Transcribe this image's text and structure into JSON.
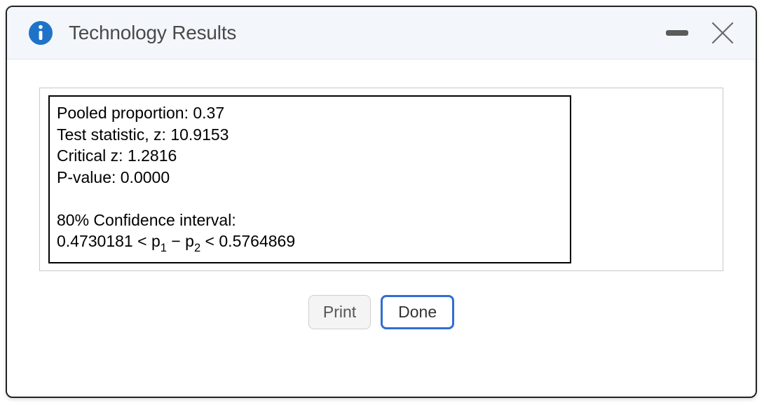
{
  "title": "Technology Results",
  "results": {
    "pooled_proportion_label": "Pooled proportion:",
    "pooled_proportion_value": "0.37",
    "test_statistic_label": "Test statistic, z:",
    "test_statistic_value": "10.9153",
    "critical_z_label": "Critical z:",
    "critical_z_value": "1.2816",
    "p_value_label": "P-value:",
    "p_value_value": "0.0000",
    "confidence_interval": {
      "level_label": "80% Confidence interval:",
      "lower": "0.4730181",
      "parameter_html": "p₁ − p₂",
      "upper": "0.5764869"
    }
  },
  "buttons": {
    "print_label": "Print",
    "done_label": "Done"
  }
}
